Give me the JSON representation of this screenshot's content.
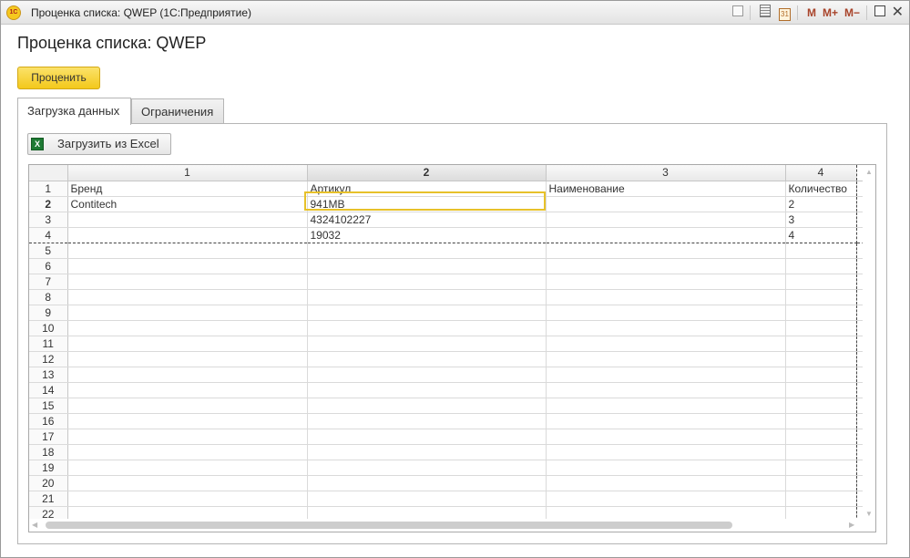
{
  "window": {
    "title": "Проценка списка: QWEP  (1С:Предприятие)",
    "app_icon_text": "1C",
    "toolbar": {
      "m": "M",
      "m_plus": "M+",
      "m_minus": "M−",
      "calendar_day": "31"
    }
  },
  "page": {
    "title": "Проценка списка: QWEP",
    "primary_button": "Проценить"
  },
  "tabs": [
    {
      "label": "Загрузка данных",
      "active": true
    },
    {
      "label": "Ограничения",
      "active": false
    }
  ],
  "panel": {
    "load_button": "Загрузить из Excel",
    "excel_icon_text": "X"
  },
  "spreadsheet": {
    "column_headers": [
      "1",
      "2",
      "3",
      "4"
    ],
    "active_column": "2",
    "row_numbers": [
      "1",
      "2",
      "3",
      "4",
      "5",
      "6",
      "7",
      "8",
      "9",
      "10",
      "11",
      "12",
      "13",
      "14",
      "15",
      "16",
      "17",
      "18",
      "19",
      "20",
      "21",
      "22"
    ],
    "active_row": "2",
    "rows": [
      [
        "Бренд",
        "Артикул",
        "Наименование",
        "Количество"
      ],
      [
        "Contitech",
        "941MB",
        "",
        "2"
      ],
      [
        "",
        "4324102227",
        "",
        "3"
      ],
      [
        "",
        "19032",
        "",
        "4"
      ]
    ],
    "selected_cell": {
      "row": "2",
      "column": "2",
      "value": "941MB"
    },
    "selection_color": "#e7c12a"
  }
}
